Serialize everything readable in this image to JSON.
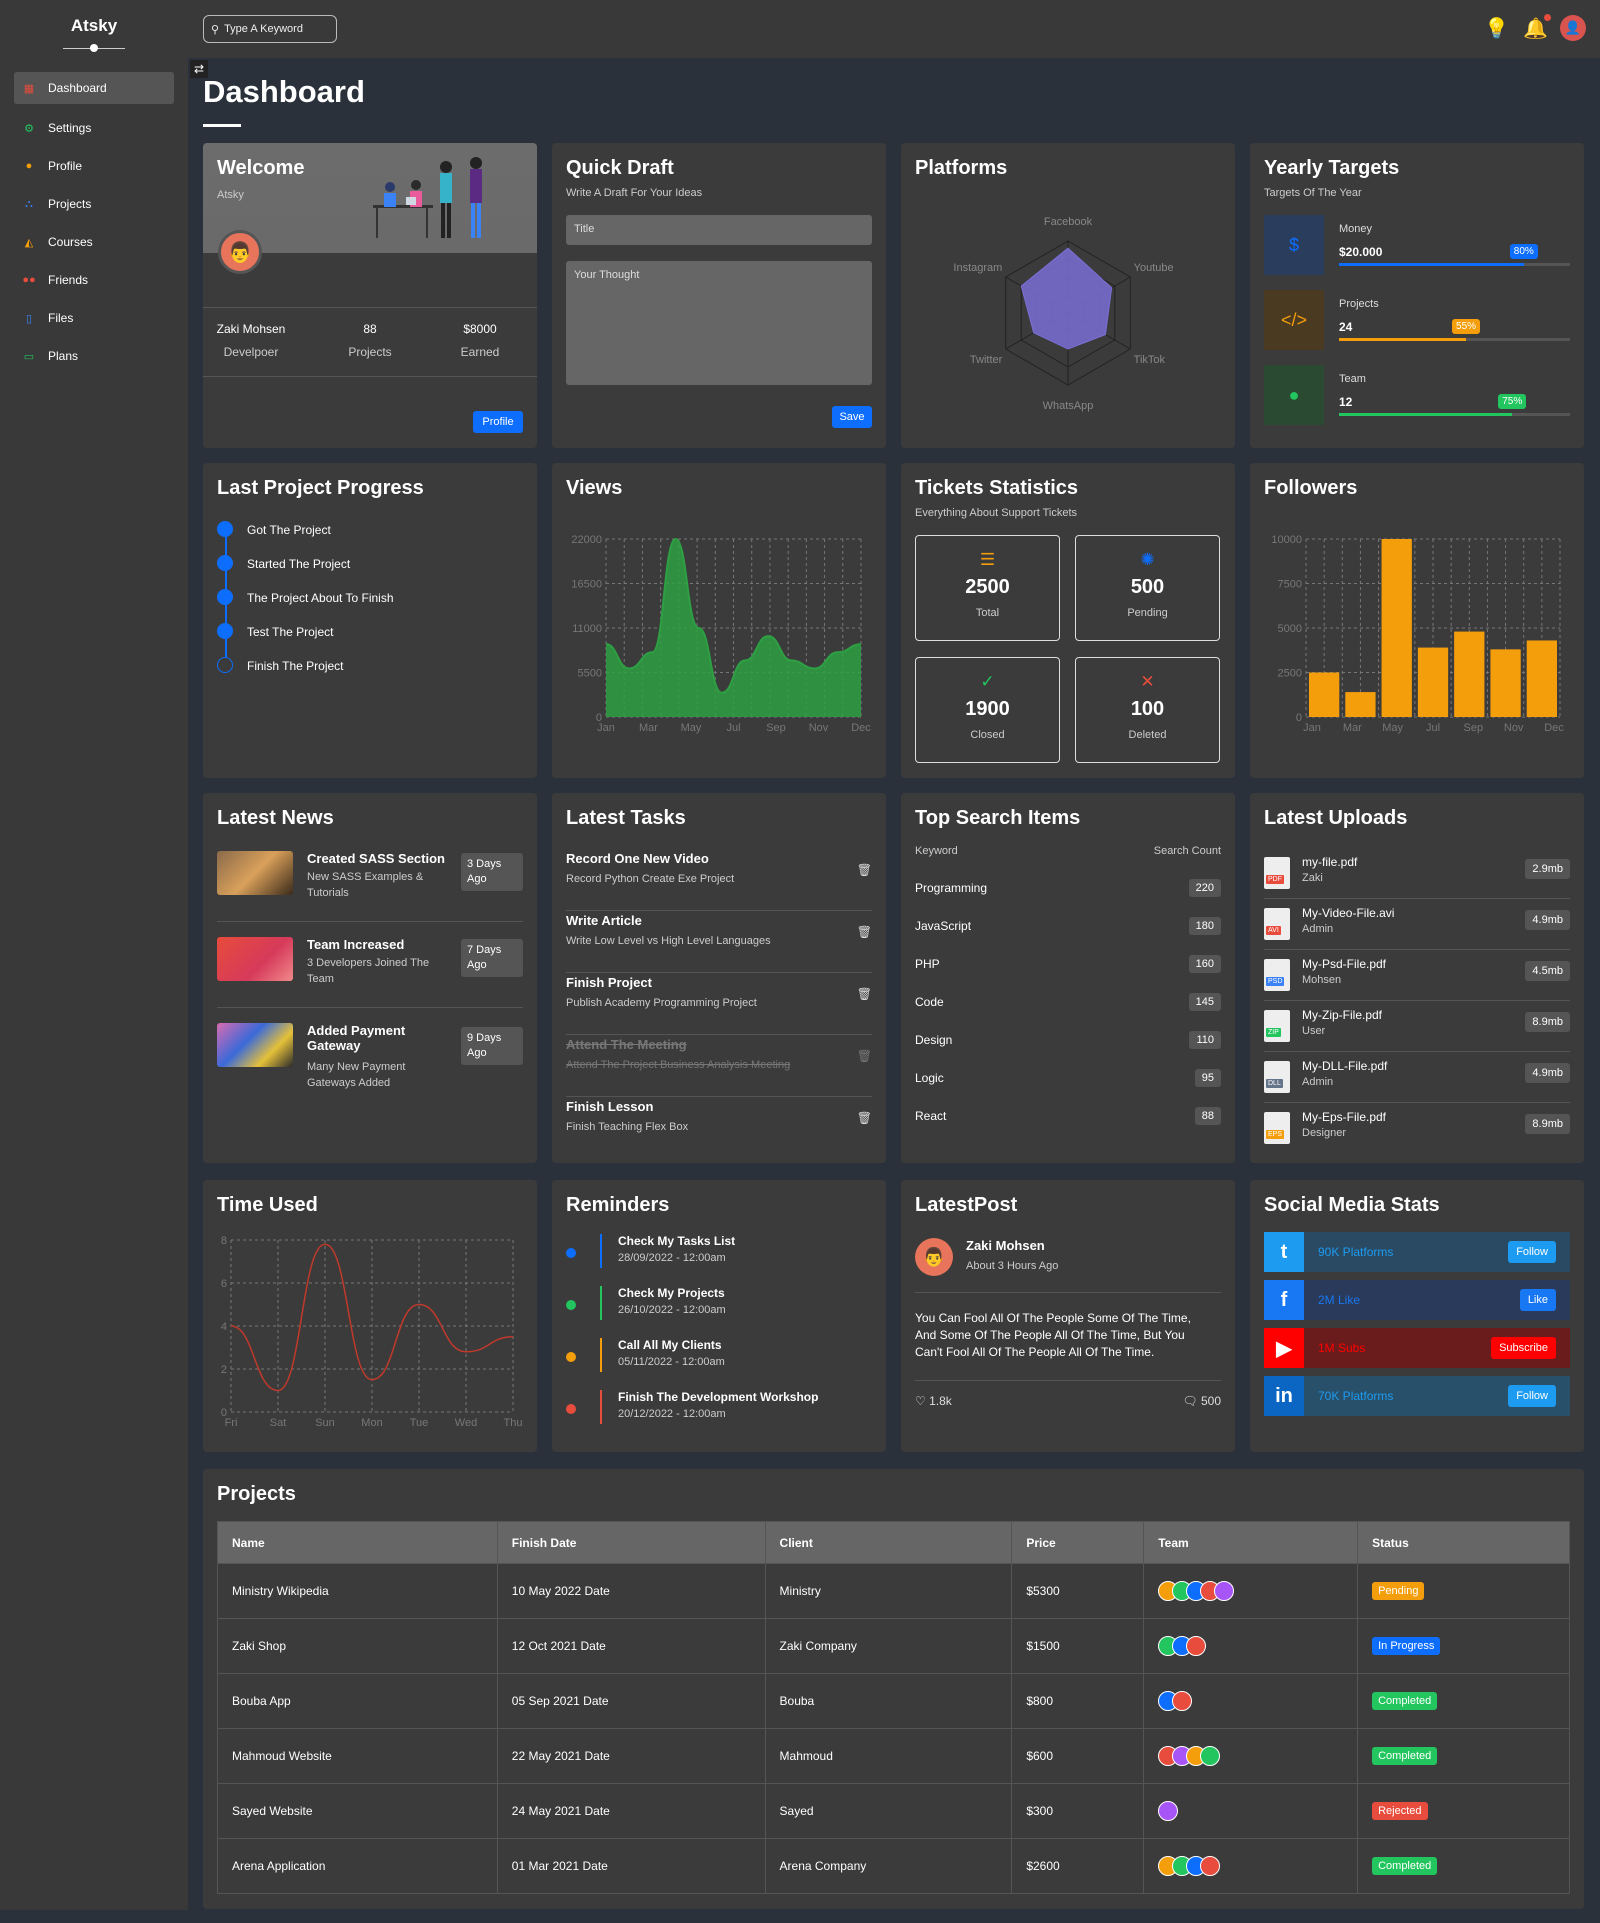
{
  "sidebar": {
    "brand": "Atsky",
    "items": [
      {
        "label": "Dashboard",
        "icon": "dashboard-icon",
        "active": true
      },
      {
        "label": "Settings",
        "icon": "gear-icon"
      },
      {
        "label": "Profile",
        "icon": "user-icon"
      },
      {
        "label": "Projects",
        "icon": "diagram-icon"
      },
      {
        "label": "Courses",
        "icon": "graduation-cap-icon"
      },
      {
        "label": "Friends",
        "icon": "users-icon"
      },
      {
        "label": "Files",
        "icon": "file-icon"
      },
      {
        "label": "Plans",
        "icon": "credit-card-icon"
      }
    ]
  },
  "topbar": {
    "search_placeholder": "Type A Keyword"
  },
  "page_title": "Dashboard",
  "welcome": {
    "title": "Welcome",
    "subtitle": "Atsky",
    "stats": [
      {
        "value": "Zaki Mohsen",
        "label": "Develpoer"
      },
      {
        "value": "88",
        "label": "Projects"
      },
      {
        "value": "$8000",
        "label": "Earned"
      }
    ],
    "button": "Profile"
  },
  "quick_draft": {
    "title": "Quick Draft",
    "subtitle": "Write A Draft For Your Ideas",
    "title_placeholder": "Title",
    "thought_placeholder": "Your Thought",
    "button": "Save"
  },
  "platforms": {
    "title": "Platforms",
    "labels": [
      "Facebook",
      "Youtube",
      "TikTok",
      "WhatsApp",
      "Twitter",
      "Instagram"
    ]
  },
  "yearly_targets": {
    "title": "Yearly Targets",
    "subtitle": "Targets Of The Year",
    "items": [
      {
        "label": "Money",
        "value": "$20.000",
        "percent": 80,
        "badge": "80%",
        "color": "#0d6efd",
        "icon": "dollar-icon",
        "icon_char": "$"
      },
      {
        "label": "Projects",
        "value": "24",
        "percent": 55,
        "badge": "55%",
        "color": "#f59e0b",
        "icon": "code-icon",
        "icon_char": "</>"
      },
      {
        "label": "Team",
        "value": "12",
        "percent": 75,
        "badge": "75%",
        "color": "#22c55e",
        "icon": "user-icon",
        "icon_char": "●"
      }
    ]
  },
  "last_project": {
    "title": "Last Project Progress",
    "steps": [
      {
        "label": "Got The Project",
        "done": true
      },
      {
        "label": "Started The Project",
        "done": true
      },
      {
        "label": "The Project About To Finish",
        "done": true
      },
      {
        "label": "Test The Project",
        "done": true
      },
      {
        "label": "Finish The Project",
        "done": false
      }
    ]
  },
  "views": {
    "title": "Views"
  },
  "tickets": {
    "title": "Tickets Statistics",
    "subtitle": "Everything About Support Tickets",
    "boxes": [
      {
        "value": "2500",
        "label": "Total",
        "icon": "list-icon",
        "icon_char": "☰",
        "color": "#f59e0b"
      },
      {
        "value": "500",
        "label": "Pending",
        "icon": "spinner-icon",
        "icon_char": "✺",
        "color": "#0d6efd"
      },
      {
        "value": "1900",
        "label": "Closed",
        "icon": "check-circle-icon",
        "icon_char": "✓",
        "color": "#22c55e"
      },
      {
        "value": "100",
        "label": "Deleted",
        "icon": "x-square-icon",
        "icon_char": "✕",
        "color": "#e74c3c"
      }
    ]
  },
  "followers": {
    "title": "Followers"
  },
  "news": {
    "title": "Latest News",
    "items": [
      {
        "title": "Created SASS Section",
        "desc": "New SASS Examples & Tutorials",
        "time": "3 Days Ago"
      },
      {
        "title": "Team Increased",
        "desc": "3 Developers Joined The Team",
        "time": "7 Days Ago"
      },
      {
        "title": "Added Payment Gateway",
        "desc": "Many New Payment Gateways Added",
        "time": "9 Days Ago"
      }
    ]
  },
  "tasks": {
    "title": "Latest Tasks",
    "items": [
      {
        "title": "Record One New Video",
        "desc": "Record Python Create Exe Project",
        "done": false
      },
      {
        "title": "Write Article",
        "desc": "Write Low Level vs High Level Languages",
        "done": false
      },
      {
        "title": "Finish Project",
        "desc": "Publish Academy Programming Project",
        "done": false
      },
      {
        "title": "Attend The Meeting",
        "desc": "Attend The Project Business Analysis Meeting",
        "done": true
      },
      {
        "title": "Finish Lesson",
        "desc": "Finish Teaching Flex Box",
        "done": false
      }
    ]
  },
  "search_items": {
    "title": "Top Search Items",
    "col_keyword": "Keyword",
    "col_count": "Search Count",
    "rows": [
      {
        "k": "Programming",
        "n": "220"
      },
      {
        "k": "JavaScript",
        "n": "180"
      },
      {
        "k": "PHP",
        "n": "160"
      },
      {
        "k": "Code",
        "n": "145"
      },
      {
        "k": "Design",
        "n": "110"
      },
      {
        "k": "Logic",
        "n": "95"
      },
      {
        "k": "React",
        "n": "88"
      }
    ]
  },
  "uploads": {
    "title": "Latest Uploads",
    "items": [
      {
        "name": "my-file.pdf",
        "by": "Zaki",
        "size": "2.9mb",
        "tag": "PDF",
        "color": "#e74c3c"
      },
      {
        "name": "My-Video-File.avi",
        "by": "Admin",
        "size": "4.9mb",
        "tag": "AVI",
        "color": "#e74c3c"
      },
      {
        "name": "My-Psd-File.pdf",
        "by": "Mohsen",
        "size": "4.5mb",
        "tag": "PSD",
        "color": "#3b82f6"
      },
      {
        "name": "My-Zip-File.pdf",
        "by": "User",
        "size": "8.9mb",
        "tag": "ZIP",
        "color": "#22c55e"
      },
      {
        "name": "My-DLL-File.pdf",
        "by": "Admin",
        "size": "4.9mb",
        "tag": "DLL",
        "color": "#64748b"
      },
      {
        "name": "My-Eps-File.pdf",
        "by": "Designer",
        "size": "8.9mb",
        "tag": "EPS",
        "color": "#f59e0b"
      }
    ]
  },
  "time_used": {
    "title": "Time Used"
  },
  "reminders": {
    "title": "Reminders",
    "items": [
      {
        "title": "Check My Tasks List",
        "date": "28/09/2022 - 12:00am",
        "color": "#0d6efd"
      },
      {
        "title": "Check My Projects",
        "date": "26/10/2022 - 12:00am",
        "color": "#22c55e"
      },
      {
        "title": "Call All My Clients",
        "date": "05/11/2022 - 12:00am",
        "color": "#f59e0b"
      },
      {
        "title": "Finish The Development Workshop",
        "date": "20/12/2022 - 12:00am",
        "color": "#e74c3c"
      }
    ]
  },
  "latest_post": {
    "title": "LatestPost",
    "author": "Zaki Mohsen",
    "time": "About 3 Hours Ago",
    "text": "You Can Fool All Of The People Some Of The Time, And Some Of The People All Of The Time, But You Can't Fool All Of The People All Of The Time.",
    "likes": "1.8k",
    "comments": "500"
  },
  "social": {
    "title": "Social Media Stats",
    "items": [
      {
        "text": "90K Platforms",
        "button": "Follow",
        "icon": "twitter-icon",
        "glyph": "t",
        "icon_bg": "#1d9bf0",
        "bg": "#2a4a63",
        "btn": "#1d9bf0"
      },
      {
        "text": "2M Like",
        "button": "Like",
        "icon": "facebook-icon",
        "glyph": "f",
        "icon_bg": "#1877f2",
        "bg": "#2a3a5a",
        "btn": "#1877f2"
      },
      {
        "text": "1M Subs",
        "button": "Subscribe",
        "icon": "youtube-icon",
        "glyph": "▶",
        "icon_bg": "#ff0000",
        "bg": "#6a1c1c",
        "btn": "#ff0000"
      },
      {
        "text": "70K Platforms",
        "button": "Follow",
        "icon": "linkedin-icon",
        "glyph": "in",
        "icon_bg": "#0a66c2",
        "bg": "#28506a",
        "btn": "#1d9bf0"
      }
    ]
  },
  "projects": {
    "title": "Projects",
    "headers": [
      "Name",
      "Finish Date",
      "Client",
      "Price",
      "Team",
      "Status"
    ],
    "rows": [
      {
        "name": "Ministry Wikipedia",
        "date": "10 May 2022 Date",
        "client": "Ministry",
        "price": "$5300",
        "team": 5,
        "status": "Pending",
        "status_color": "#f59e0b"
      },
      {
        "name": "Zaki Shop",
        "date": "12 Oct 2021 Date",
        "client": "Zaki Company",
        "price": "$1500",
        "team": 3,
        "status": "In Progress",
        "status_color": "#0d6efd"
      },
      {
        "name": "Bouba App",
        "date": "05 Sep 2021 Date",
        "client": "Bouba",
        "price": "$800",
        "team": 2,
        "status": "Completed",
        "status_color": "#22c55e"
      },
      {
        "name": "Mahmoud Website",
        "date": "22 May 2021 Date",
        "client": "Mahmoud",
        "price": "$600",
        "team": 4,
        "status": "Completed",
        "status_color": "#22c55e"
      },
      {
        "name": "Sayed Website",
        "date": "24 May 2021 Date",
        "client": "Sayed",
        "price": "$300",
        "team": 1,
        "status": "Rejected",
        "status_color": "#e74c3c"
      },
      {
        "name": "Arena Application",
        "date": "01 Mar 2021 Date",
        "client": "Arena Company",
        "price": "$2600",
        "team": 4,
        "status": "Completed",
        "status_color": "#22c55e"
      }
    ]
  },
  "chart_data": [
    {
      "type": "radar",
      "title": "Platforms",
      "labels": [
        "Facebook",
        "Youtube",
        "TikTok",
        "WhatsApp",
        "Twitter",
        "Instagram"
      ],
      "values": [
        90,
        70,
        60,
        50,
        55,
        75
      ],
      "max": 100
    },
    {
      "type": "area",
      "title": "Views",
      "x": [
        "Jan",
        "Feb",
        "Mar",
        "Apr",
        "May",
        "Jun",
        "Jul",
        "Aug",
        "Sep",
        "Oct",
        "Nov",
        "Dec"
      ],
      "xticks": [
        "Jan",
        "Mar",
        "May",
        "Jul",
        "Sep",
        "Nov",
        "Dec"
      ],
      "values": [
        9000,
        6000,
        8000,
        22000,
        11000,
        3000,
        7000,
        10000,
        7000,
        6000,
        8000,
        9000
      ],
      "ylim": [
        0,
        22000
      ],
      "yticks": [
        0,
        5500,
        11000,
        16500,
        22000
      ],
      "color": "#2ea043"
    },
    {
      "type": "bar",
      "title": "Followers",
      "x": [
        "Jan",
        "Feb",
        "Mar",
        "Apr",
        "May",
        "Jun",
        "Jul",
        "Aug",
        "Sep",
        "Oct",
        "Nov",
        "Dec"
      ],
      "xticks": [
        "Jan",
        "Mar",
        "May",
        "Jul",
        "Sep",
        "Nov",
        "Dec"
      ],
      "values": [
        2500,
        1400,
        10000,
        3900,
        4800,
        3800,
        4300
      ],
      "ylim": [
        0,
        10000
      ],
      "yticks": [
        0,
        2500,
        5000,
        7500,
        10000
      ],
      "color": "#f59e0b"
    },
    {
      "type": "line",
      "title": "Time Used",
      "x": [
        "Fri",
        "Sat",
        "Sun",
        "Mon",
        "Tue",
        "Wed",
        "Thu"
      ],
      "values": [
        4,
        1,
        7.8,
        1.5,
        5,
        2.8,
        3.5
      ],
      "ylim": [
        0,
        8
      ],
      "yticks": [
        0,
        2,
        4,
        6,
        8
      ],
      "color": "#c0392b"
    }
  ]
}
